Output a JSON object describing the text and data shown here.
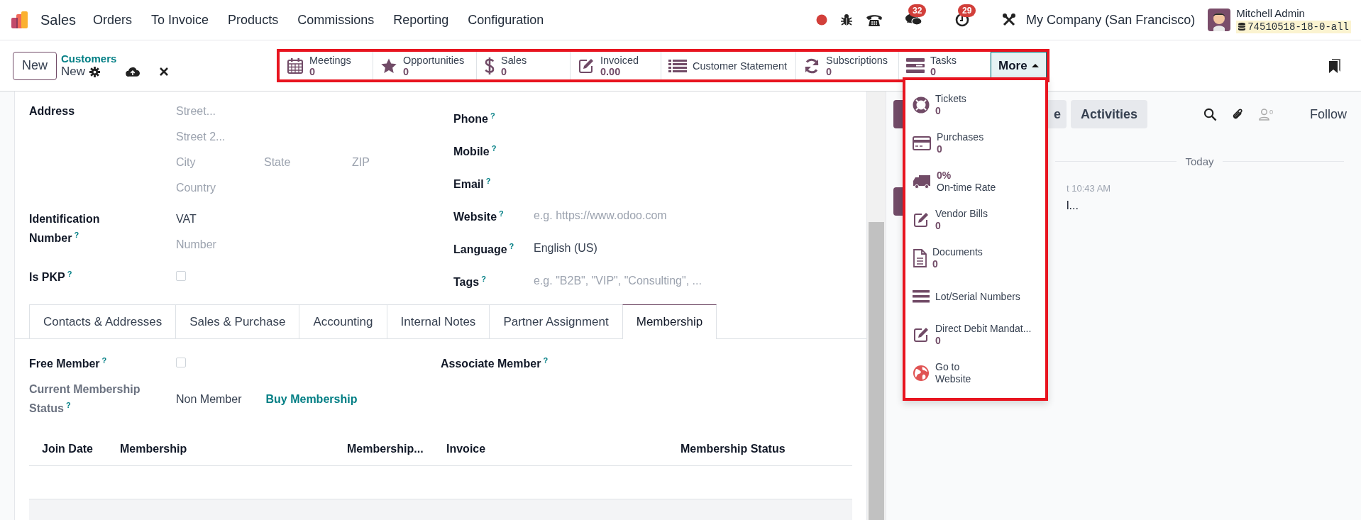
{
  "navbar": {
    "app": "Sales",
    "menu": [
      "Orders",
      "To Invoice",
      "Products",
      "Commissions",
      "Reporting",
      "Configuration"
    ],
    "chat_count": "32",
    "activity_count": "29",
    "company": "My Company (San Francisco)",
    "user": "Mitchell Admin",
    "database": "74510518-18-0-all"
  },
  "control_panel": {
    "new_button": "New",
    "breadcrumb": "Customers",
    "record": "New"
  },
  "smart_button_box": {
    "highlighted": true,
    "buttons": [
      {
        "kind": "stat",
        "label": "Meetings",
        "value": "0"
      },
      {
        "kind": "stat",
        "label": "Opportunities",
        "value": "0"
      },
      {
        "kind": "stat",
        "label": "Sales",
        "value": "0"
      },
      {
        "kind": "stat",
        "label": "Invoiced",
        "value": "0.00"
      },
      {
        "kind": "action",
        "label": "Customer Statement"
      },
      {
        "kind": "stat",
        "label": "Subscriptions",
        "value": "0"
      },
      {
        "kind": "stat",
        "label": "Tasks",
        "value": "0"
      }
    ],
    "more_button": {
      "label": "More",
      "expanded": true
    }
  },
  "more_menu": {
    "highlighted": true,
    "items": [
      {
        "kind": "stat",
        "label": "Tickets",
        "value": "0"
      },
      {
        "kind": "stat",
        "label": "Purchases",
        "value": "0"
      },
      {
        "kind": "value_first",
        "value": "0%",
        "label": "On-time Rate"
      },
      {
        "kind": "stat",
        "label": "Vendor Bills",
        "value": "0"
      },
      {
        "kind": "stat",
        "label": "Documents",
        "value": "0"
      },
      {
        "kind": "action",
        "label": "Lot/Serial Numbers"
      },
      {
        "kind": "stat",
        "label": "Direct Debit Mandat...",
        "value": "0"
      },
      {
        "kind": "two_line",
        "label": "Go to",
        "sublabel": "Website"
      }
    ]
  },
  "form": {
    "left": [
      {
        "kind": "address",
        "label": "Address",
        "placeholders": [
          "Street...",
          "Street 2...",
          "City",
          "State",
          "ZIP",
          "Country"
        ]
      },
      {
        "kind": "ident",
        "label": "Identification Number",
        "help": "?",
        "value": "VAT",
        "placeholder": "Number"
      },
      {
        "kind": "checkbox",
        "label": "Is PKP",
        "help": "?",
        "checked": false
      }
    ],
    "right": [
      {
        "label": "Phone",
        "help": "?"
      },
      {
        "label": "Mobile",
        "help": "?"
      },
      {
        "label": "Email",
        "help": "?"
      },
      {
        "label": "Website",
        "help": "?",
        "placeholder": "e.g. https://www.odoo.com"
      },
      {
        "label": "Language",
        "help": "?",
        "value": "English (US)"
      },
      {
        "label": "Tags",
        "help": "?",
        "placeholder": "e.g. \"B2B\", \"VIP\", \"Consulting\", ..."
      }
    ]
  },
  "tabs": [
    {
      "label": "Contacts & Addresses",
      "selected": false
    },
    {
      "label": "Sales & Purchase",
      "selected": false
    },
    {
      "label": "Accounting",
      "selected": false
    },
    {
      "label": "Internal Notes",
      "selected": false
    },
    {
      "label": "Partner Assignment",
      "selected": false
    },
    {
      "label": "Membership",
      "selected": true
    }
  ],
  "membership": {
    "free_member": {
      "label": "Free Member",
      "help": "?",
      "checked": false
    },
    "associate_member": {
      "label": "Associate Member",
      "help": "?"
    },
    "status": {
      "label": "Current Membership Status",
      "help": "?",
      "value": "Non Member",
      "link": "Buy Membership"
    },
    "table": {
      "columns": [
        "Join Date",
        "Membership",
        "Membership...",
        "Invoice",
        "Membership Status"
      ]
    }
  },
  "chatter": {
    "log_button": "e",
    "activities_button": "Activities",
    "followers_count": "0",
    "follow_button": "Follow",
    "date_separator": "Today",
    "message_time": "t 10:43 AM",
    "message_text": "l..."
  }
}
